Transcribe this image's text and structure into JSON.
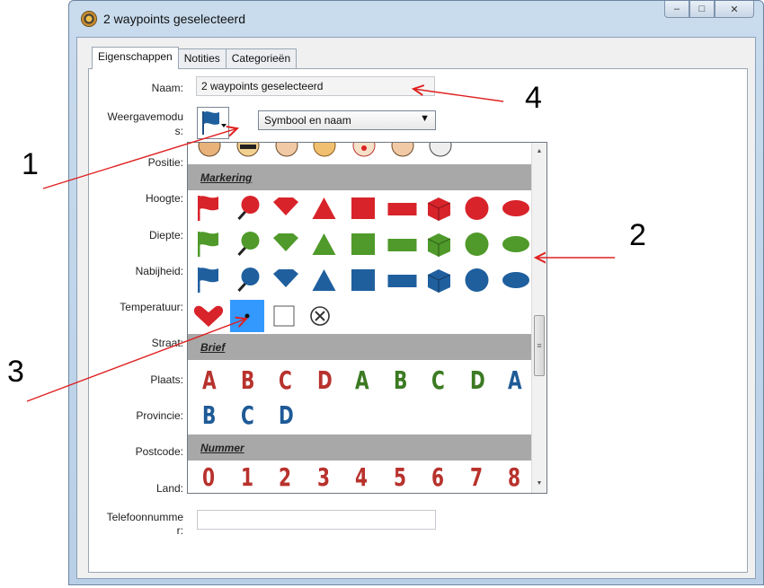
{
  "window": {
    "title": "2 waypoints geselecteerd",
    "controls": {
      "minimize": "–",
      "maximize": "□",
      "close": "✕"
    }
  },
  "tabs": [
    {
      "label": "Eigenschappen",
      "active": true
    },
    {
      "label": "Notities",
      "active": false
    },
    {
      "label": "Categorieën",
      "active": false
    }
  ],
  "fields": {
    "name_label": "Naam:",
    "name_value": "2 waypoints geselecteerd",
    "display_mode_label_1": "Weergavemodu",
    "display_mode_label_2": "s:",
    "display_mode_value": "Symbool en naam",
    "position_label": "Positie:",
    "height_label": "Hoogte:",
    "depth_label": "Diepte:",
    "proximity_label": "Nabijheid:",
    "temperature_label": "Temperatuur:",
    "street_label": "Straat:",
    "city_label": "Plaats:",
    "province_label": "Provincie:",
    "postcode_label": "Postcode:",
    "country_label": "Land:",
    "phone_label_1": "Telefoonnumme",
    "phone_label_2": "r:"
  },
  "symbol_popup": {
    "sections": [
      "Markering",
      "Brief",
      "Nummer"
    ],
    "letters_row1": [
      "A",
      "B",
      "C",
      "D",
      "A",
      "B",
      "C",
      "D",
      "A"
    ],
    "letters_row2": [
      "B",
      "C",
      "D"
    ],
    "numbers_row": [
      "0",
      "1",
      "2",
      "3",
      "4",
      "5",
      "6",
      "7",
      "8"
    ],
    "colors": {
      "red": "#d8232a",
      "green": "#4f9a2a",
      "blue": "#1f5f9e",
      "letter_red": "#b8322d",
      "letter_green": "#3c7a22",
      "letter_blue": "#1e5a96",
      "selection": "#3399ff"
    },
    "symbol_shapes": [
      "flag",
      "pin",
      "diamond",
      "triangle",
      "square",
      "rectangle",
      "cube",
      "circle",
      "oval"
    ],
    "misc_symbols": [
      "heart-icon",
      "dot-icon",
      "empty-square-icon",
      "no-symbol-icon"
    ]
  },
  "annotations": [
    "1",
    "2",
    "3",
    "4"
  ],
  "colors": {
    "annotation_arrow": "#e02020"
  }
}
